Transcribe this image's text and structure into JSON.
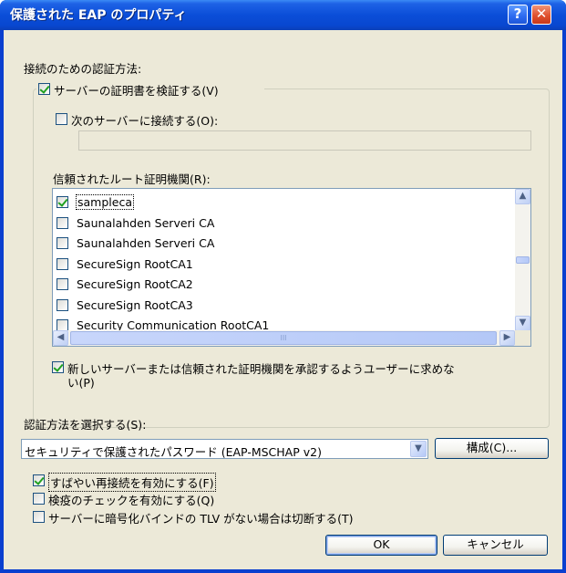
{
  "window": {
    "title": "保護された EAP のプロパティ",
    "help_label": "?",
    "close_label": "✕"
  },
  "auth_connect_label": "接続のための認証方法:",
  "validate_cert": {
    "label": "サーバーの証明書を検証する(V)",
    "checked": true
  },
  "connect_servers": {
    "label": "次のサーバーに接続する(O):",
    "checked": false,
    "value": ""
  },
  "trusted_root_label": "信頼されたルート証明機関(R):",
  "trusted_roots": [
    {
      "label": "sampleca",
      "checked": true
    },
    {
      "label": "Saunalahden Serveri CA",
      "checked": false
    },
    {
      "label": "Saunalahden Serveri CA",
      "checked": false
    },
    {
      "label": "SecureSign RootCA1",
      "checked": false
    },
    {
      "label": "SecureSign RootCA2",
      "checked": false
    },
    {
      "label": "SecureSign RootCA3",
      "checked": false
    },
    {
      "label": "Security Communication RootCA1",
      "checked": false
    }
  ],
  "scrollbar": {
    "up": "▲",
    "down": "▼",
    "left": "◀",
    "right": "▶",
    "grip": "III"
  },
  "prompt_user": {
    "label_line1": "新しいサーバーまたは信頼された証明機関を承認するようユーザーに求めな",
    "label_line2": "い(P)",
    "checked": true
  },
  "select_auth_label": "認証方法を選択する(S):",
  "auth_method": {
    "selected": "セキュリティで保護されたパスワード (EAP-MSCHAP v2)",
    "arrow": "▼"
  },
  "configure_button": "構成(C)...",
  "fast_reconnect": {
    "label": "すばやい再接続を有効にする(F)",
    "checked": true
  },
  "quarantine": {
    "label": "検疫のチェックを有効にする(Q)",
    "checked": false
  },
  "disconnect_tlv": {
    "label": "サーバーに暗号化バインドの TLV がない場合は切断する(T)",
    "checked": false
  },
  "ok_button": "OK",
  "cancel_button": "キャンセル"
}
